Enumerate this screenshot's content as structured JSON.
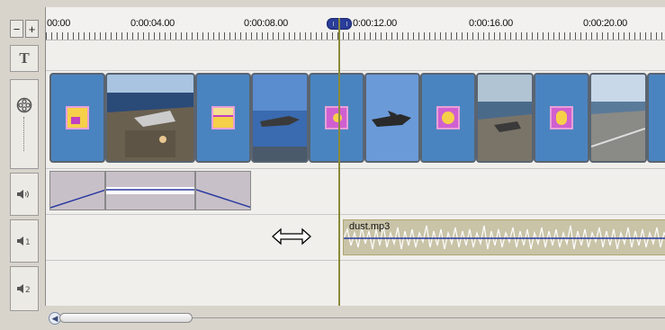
{
  "ruler": {
    "labels": [
      "00:00",
      "0:00:04.00",
      "0:00:08.00",
      "0:00:12.00",
      "0:00:16.00",
      "0:00:20.00"
    ]
  },
  "controls": {
    "zoom_out": "−",
    "zoom_in": "+",
    "title_track": "T"
  },
  "music_track": {
    "clip_name": "dust.mp3"
  },
  "track_icons": {
    "video": "film-reel-icon",
    "voice": "speaker-icon",
    "music1": "speaker-1-icon",
    "music2": "speaker-2-icon"
  },
  "colors": {
    "playhead": "#2a3d9a",
    "transition_bg": "#4a84c0",
    "envelope": "#2a3aa0",
    "music_wave": "#ffffff"
  }
}
